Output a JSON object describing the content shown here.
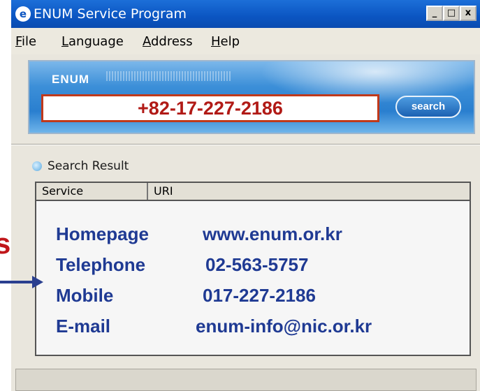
{
  "window": {
    "title": "ENUM Service Program",
    "controls": {
      "minimize": "_",
      "maximize": "□",
      "close": "x"
    }
  },
  "menu": {
    "file": {
      "accel": "F",
      "rest": "ile"
    },
    "language": {
      "accel": "L",
      "rest": "anguage"
    },
    "address": {
      "accel": "A",
      "rest": "ddress"
    },
    "help": {
      "accel": "H",
      "rest": "elp"
    }
  },
  "banner": {
    "label": "ENUM",
    "number_value": "+82-17-227-2186",
    "search_label": "search"
  },
  "results": {
    "title": "Search Result",
    "columns": [
      "Service",
      "URI"
    ],
    "rows": [
      {
        "service": "Homepage",
        "uri": "www.enum.or.kr"
      },
      {
        "service": "Telephone",
        "uri": "02-563-5757"
      },
      {
        "service": "Mobile",
        "uri": "017-227-2186"
      },
      {
        "service": "E-mail",
        "uri": "enum-info@nic.or.kr"
      }
    ]
  },
  "side": {
    "partial_text": "s"
  },
  "colors": {
    "titlebar": "#0b55c2",
    "input_border": "#c0391b",
    "input_text": "#b11a16",
    "result_text": "#1f3a93",
    "arrow": "#2a3f8f"
  }
}
